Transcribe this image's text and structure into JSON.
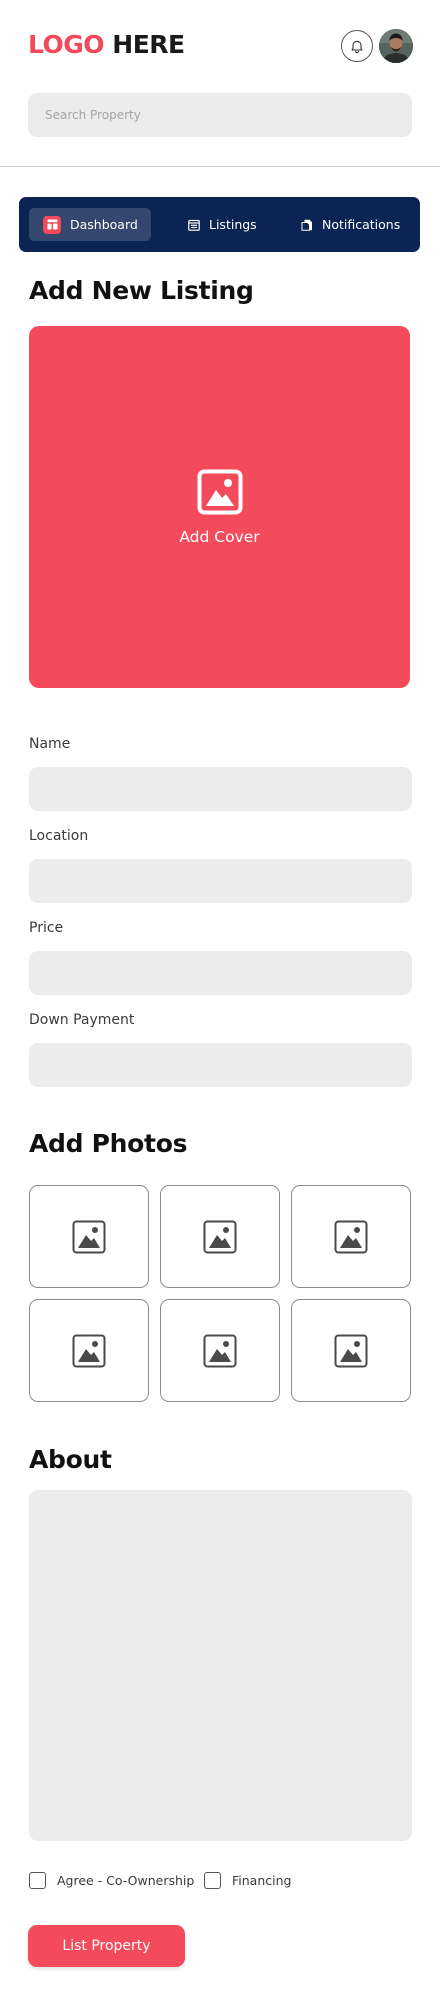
{
  "brand": {
    "logo_accent": "LOGO",
    "logo_rest": " HERE",
    "accent_color": "#f24a5a",
    "nav_color": "#0b2454"
  },
  "header": {
    "notification_icon": "bell-icon",
    "avatar_icon": "user-avatar"
  },
  "search": {
    "placeholder": "Search Property",
    "value": ""
  },
  "nav": {
    "items": [
      {
        "label": "Dashboard",
        "icon": "dashboard-icon",
        "active": true
      },
      {
        "label": "Listings",
        "icon": "calendar-list-icon",
        "active": false
      },
      {
        "label": "Notifications",
        "icon": "document-icon",
        "active": false
      }
    ]
  },
  "page": {
    "title": "Add New Listing",
    "cover_label": "Add Cover",
    "cover_icon": "image-icon"
  },
  "form": {
    "fields": [
      {
        "label": "Name",
        "value": ""
      },
      {
        "label": "Location",
        "value": ""
      },
      {
        "label": "Price",
        "value": ""
      },
      {
        "label": "Down Payment",
        "value": ""
      }
    ]
  },
  "photos": {
    "title": "Add Photos",
    "slot_icon": "image-icon",
    "slot_count": 6
  },
  "about": {
    "title": "About",
    "value": ""
  },
  "options": {
    "co_ownership_label": "Agree - Co-Ownership",
    "financing_label": "Financing",
    "co_ownership_checked": false,
    "financing_checked": false
  },
  "submit": {
    "label": "List Property"
  }
}
